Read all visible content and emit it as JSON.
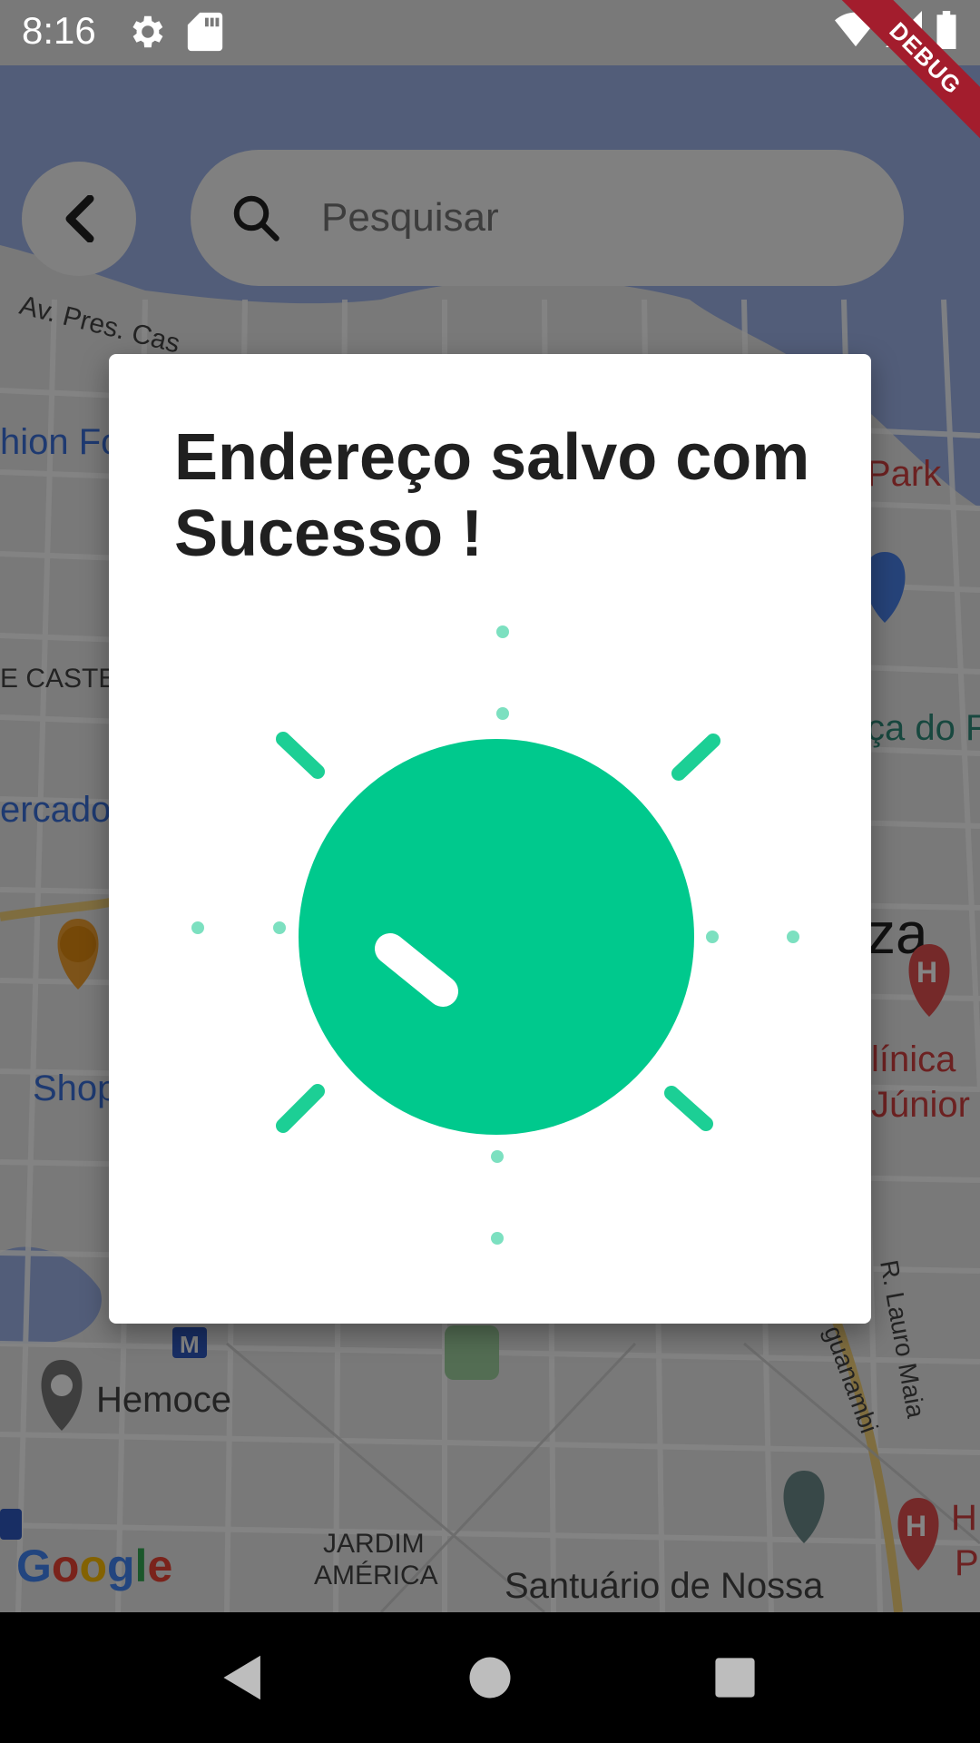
{
  "status_bar": {
    "time": "8:16",
    "icons": [
      "gear-icon",
      "sd-card-icon",
      "wifi-icon",
      "signal-icon",
      "battery-icon"
    ],
    "debug_banner": "DEBUG"
  },
  "map": {
    "labels": {
      "street_av_pres": "Av. Pres. Cas",
      "fashion": "hion Fo",
      "park": "Park",
      "castel": "E CASTEL",
      "praca": "ça do F",
      "mercado": "ercado",
      "city": "za",
      "clinica_1": "línica",
      "clinica_2": "Júnior",
      "shop": "Shop",
      "hemoce": "Hemoce",
      "jardim_1": "JARDIM",
      "jardim_2": "AMÉRICA",
      "santuario": "Santuário de Nossa",
      "r_lauro": "R. Lauro Maia",
      "aguanambi": "guanambi",
      "hosp_1": "H",
      "hosp_2": "P"
    },
    "google_logo": "Google",
    "metro_badge": "M"
  },
  "search": {
    "placeholder": "Pesquisar",
    "value": ""
  },
  "dialog": {
    "title": "Endereço salvo com Sucesso !",
    "accent_color": "#00C98D",
    "animation_icon": "success-burst-icon"
  },
  "nav_bar": {
    "back_icon": "triangle-back-icon",
    "home_icon": "circle-home-icon",
    "recents_icon": "square-recents-icon"
  }
}
